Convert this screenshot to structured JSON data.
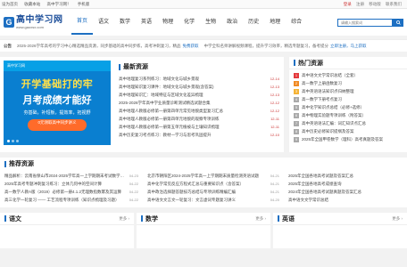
{
  "topbar": {
    "left": [
      "设为首页",
      "收藏本站",
      "高中学习网！",
      "手机版"
    ],
    "right": [
      "登录",
      "注册",
      "移动版",
      "联系我们"
    ]
  },
  "brand": {
    "logo_letter": "G",
    "name": "高中学习网",
    "domain": "www.gaoxsx.com"
  },
  "nav": {
    "items": [
      "首页",
      "语文",
      "数学",
      "英语",
      "物理",
      "化学",
      "生物",
      "政治",
      "历史",
      "地理",
      "综合"
    ],
    "active_index": 0
  },
  "search": {
    "placeholder": "请输入搜索词",
    "button_icon": "search-icon"
  },
  "notice": {
    "tag": "公告",
    "text1": "2025-2026学年高考的学习中心精选精品资源，同步基础的高中同步练，高考冲刺复习，精品",
    "link1": "免费获取",
    "text2": "中学全科名师讲解视频课程，提升学习效率，精选专题复习，备考提分",
    "link2": "立即注册，马上获取"
  },
  "banner": {
    "brand": "高中学习网",
    "line1": "开学基础打的牢",
    "line2": "月考成绩才能好",
    "sub": "夯基础，补短板，提效率，拓视野",
    "pill": "0元领取高中同步讲义"
  },
  "latest": {
    "title": "最新资源",
    "items": [
      {
        "title": "高中地理复习系列练习：地域文化与城乡景观",
        "date": "12-14"
      },
      {
        "title": "高中地理知识复习课件：地域文化与城乡景观(含答案)",
        "date": "12-13"
      },
      {
        "title": "高中地理知识汇：地域特征与区域文化差异梳理",
        "date": "12-13"
      },
      {
        "title": "2025-2026学年高中学业质量诊断测试精选试题合集",
        "date": "12-12"
      },
      {
        "title": "高中地理人教版必修第一册第四单元常见地貌类型复习汇总",
        "date": "12-12"
      },
      {
        "title": "高中地理人教版必修第一册第四单元地貌的观察专项训练",
        "date": "12-11"
      },
      {
        "title": "高中地理人教版必修第一册第五单元植被与土壤知识梳理",
        "date": "12-11"
      },
      {
        "title": "高中历史复习考点练习：教材一学习与思考巩固提升",
        "date": "12-10"
      }
    ]
  },
  "hot": {
    "title": "热门资源",
    "items": [
      "高中语文文学常识总结（全套）",
      "高一数学上册函数复习",
      "高中英语语法知识点归纳整理",
      "高一数学下册考点复习",
      "高中化学知识点总结（必修+选修）",
      "高中物理实验题专项训练（附答案）",
      "高中英语语法汇编：词汇知识点汇总",
      "高中历史必修知识提纲及答案",
      "2025年全国甲卷数学（理科）高考真题及答案"
    ]
  },
  "recommend": {
    "title": "推荐资源",
    "col1": [
      {
        "title": "精品解析：云南省保山市2024-2025学年高一上学期期末考试数学试题",
        "date": "04-23"
      },
      {
        "title": "2025年高考专题冲刺复习练习：立体几何中的空间计算",
        "date": "04-22"
      },
      {
        "title": "高一数学人教A版（2019）必修第一册4.1.2无理数指数幂及其运算",
        "date": "04-22"
      },
      {
        "title": "高三化学一轮复习 —— 工艺流程专项训练（知识点梳理及习题）",
        "date": "04-22"
      }
    ],
    "col2": [
      {
        "title": "北京市朝阳区2024-2025学年高一上学期期末质量检测英语试题",
        "date": "04-21"
      },
      {
        "title": "高中化学常见反应方程式汇总与重要知识点（含答案）",
        "date": "04-21"
      },
      {
        "title": "高中政治选择题答题技巧总结与专项训练精编汇编",
        "date": "04-21"
      },
      {
        "title": "高中语文文言文一轮复习：文言虚词专题复习讲义",
        "date": "04-20"
      }
    ],
    "col3": [
      "2025年全国各地高考试题及答案汇总",
      "2025年全国各地高考成绩查询",
      "2024年全国各地高考试题真题及答案汇总",
      "高中语文文学常识总结"
    ]
  },
  "subjects": [
    {
      "title": "语文",
      "more": "更多 ›"
    },
    {
      "title": "数学",
      "more": "更多 ›"
    },
    {
      "title": "英语",
      "more": "更多 ›"
    }
  ]
}
